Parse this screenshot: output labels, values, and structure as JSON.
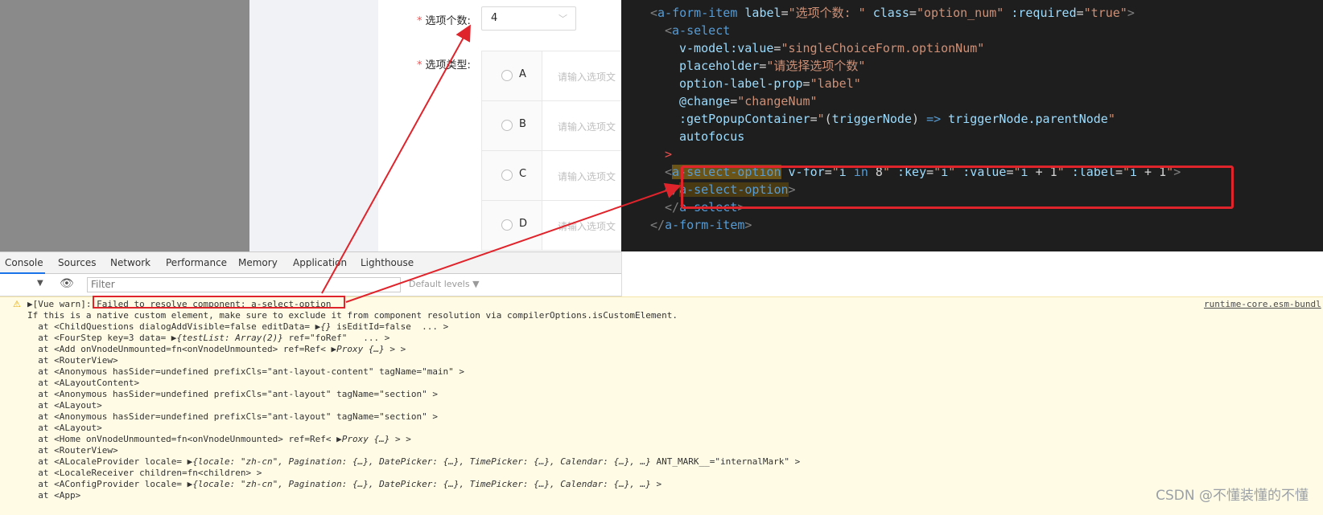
{
  "form": {
    "option_num_label": "选项个数:",
    "option_num_value": "4",
    "option_type_label": "选项类型:",
    "required_mark": "*",
    "input_placeholder": "请输入选项文",
    "options": [
      "A",
      "B",
      "C",
      "D"
    ]
  },
  "code": {
    "lines": [
      {
        "segs": [
          [
            "c-punc",
            "<"
          ],
          [
            "c-tag",
            "a-form-item"
          ],
          [
            "c-op",
            " "
          ],
          [
            "c-attr",
            "label"
          ],
          [
            "c-op",
            "="
          ],
          [
            "c-str",
            "\"选项个数: \""
          ],
          [
            "c-op",
            " "
          ],
          [
            "c-attr",
            "class"
          ],
          [
            "c-op",
            "="
          ],
          [
            "c-str",
            "\"option_num\""
          ],
          [
            "c-op",
            " "
          ],
          [
            "c-attr",
            ":required"
          ],
          [
            "c-op",
            "="
          ],
          [
            "c-str",
            "\"true\""
          ],
          [
            "c-punc",
            ">"
          ]
        ],
        "indent": 1
      },
      {
        "segs": [
          [
            "c-punc",
            "<"
          ],
          [
            "c-tag",
            "a-select"
          ]
        ],
        "indent": 2
      },
      {
        "segs": [
          [
            "c-attr",
            "v-model:value"
          ],
          [
            "c-op",
            "="
          ],
          [
            "c-str",
            "\"singleChoiceForm.optionNum\""
          ]
        ],
        "indent": 3
      },
      {
        "segs": [
          [
            "c-attr",
            "placeholder"
          ],
          [
            "c-op",
            "="
          ],
          [
            "c-str",
            "\"请选择选项个数\""
          ]
        ],
        "indent": 3
      },
      {
        "segs": [
          [
            "c-attr",
            "option-label-prop"
          ],
          [
            "c-op",
            "="
          ],
          [
            "c-str",
            "\"label\""
          ]
        ],
        "indent": 3
      },
      {
        "segs": [
          [
            "c-attr",
            "@change"
          ],
          [
            "c-op",
            "="
          ],
          [
            "c-str",
            "\"changeNum\""
          ]
        ],
        "indent": 3
      },
      {
        "segs": [
          [
            "c-attr",
            ":getPopupContainer"
          ],
          [
            "c-op",
            "="
          ],
          [
            "c-str",
            "\""
          ],
          [
            "c-op",
            "("
          ],
          [
            "c-attr",
            "triggerNode"
          ],
          [
            "c-op",
            ") "
          ],
          [
            "c-tag",
            "=>"
          ],
          [
            "c-op",
            " "
          ],
          [
            "c-attr",
            "triggerNode.parentNode"
          ],
          [
            "c-str",
            "\""
          ]
        ],
        "indent": 3
      },
      {
        "segs": [
          [
            "c-attr",
            "autofocus"
          ]
        ],
        "indent": 3
      },
      {
        "segs": [
          [
            "c-red",
            ">"
          ]
        ],
        "indent": 2
      },
      {
        "segs": [
          [
            "c-punc",
            "<"
          ],
          [
            "c-hl",
            "a-select-option"
          ],
          [
            "c-op",
            " "
          ],
          [
            "c-attr",
            "v-for"
          ],
          [
            "c-op",
            "="
          ],
          [
            "c-str",
            "\""
          ],
          [
            "c-attr",
            "i"
          ],
          [
            "c-op",
            " "
          ],
          [
            "c-tag",
            "in"
          ],
          [
            "c-op",
            " 8"
          ],
          [
            "c-str",
            "\""
          ],
          [
            "c-op",
            " "
          ],
          [
            "c-attr",
            ":key"
          ],
          [
            "c-op",
            "="
          ],
          [
            "c-str",
            "\""
          ],
          [
            "c-attr",
            "i"
          ],
          [
            "c-str",
            "\""
          ],
          [
            "c-op",
            " "
          ],
          [
            "c-attr",
            ":value"
          ],
          [
            "c-op",
            "="
          ],
          [
            "c-str",
            "\""
          ],
          [
            "c-attr",
            "i"
          ],
          [
            "c-op",
            " + 1"
          ],
          [
            "c-str",
            "\""
          ],
          [
            "c-op",
            " "
          ],
          [
            "c-attr",
            ":label"
          ],
          [
            "c-op",
            "="
          ],
          [
            "c-str",
            "\""
          ],
          [
            "c-attr",
            "i"
          ],
          [
            "c-op",
            " + 1"
          ],
          [
            "c-str",
            "\""
          ],
          [
            "c-punc",
            ">"
          ]
        ],
        "indent": 2
      },
      {
        "segs": [
          [
            "c-punc",
            "</"
          ],
          [
            "c-hl2 c-tag",
            "a-select-option"
          ],
          [
            "c-punc",
            ">"
          ]
        ],
        "indent": 2
      },
      {
        "segs": [
          [
            "c-punc",
            "</"
          ],
          [
            "c-tag",
            "a-select"
          ],
          [
            "c-punc",
            ">"
          ]
        ],
        "indent": 2
      },
      {
        "segs": [
          [
            "c-punc",
            "</"
          ],
          [
            "c-tag",
            "a-form-item"
          ],
          [
            "c-punc",
            ">"
          ]
        ],
        "indent": 1
      }
    ]
  },
  "devtools": {
    "tabs": [
      "Console",
      "Sources",
      "Network",
      "Performance",
      "Memory",
      "Application",
      "Lighthouse"
    ],
    "filter_placeholder": "Filter",
    "levels_label": "Default levels ▼",
    "side_link": "runtime-core.esm-bundl"
  },
  "console": {
    "lines": [
      [
        [
          "",
          "▶[Vue warn]: "
        ],
        [
          "",
          "Failed to resolve component: a-select-option"
        ]
      ],
      [
        [
          "",
          "If this is a native custom element, make sure to exclude it from component resolution via compilerOptions.isCustomElement."
        ]
      ],
      [
        [
          "",
          "  at <ChildQuestions dialogAddVisible=false editData= ▶"
        ],
        [
          "italic",
          "{}"
        ],
        [
          "",
          " isEditId=false  ... >"
        ]
      ],
      [
        [
          "",
          "  at <FourStep key=3 data= ▶"
        ],
        [
          "italic",
          "{testList: Array(2)}"
        ],
        [
          "",
          " ref=\"foRef\"   ... >"
        ]
      ],
      [
        [
          "",
          "  at <Add onVnodeUnmounted=fn<onVnodeUnmounted> ref=Ref< ▶"
        ],
        [
          "italic",
          "Proxy {…}"
        ],
        [
          "",
          " > >"
        ]
      ],
      [
        [
          "",
          "  at <RouterView>"
        ]
      ],
      [
        [
          "",
          "  at <Anonymous hasSider=undefined prefixCls=\"ant-layout-content\" tagName=\"main\" >"
        ]
      ],
      [
        [
          "",
          "  at <ALayoutContent>"
        ]
      ],
      [
        [
          "",
          "  at <Anonymous hasSider=undefined prefixCls=\"ant-layout\" tagName=\"section\" >"
        ]
      ],
      [
        [
          "",
          "  at <ALayout>"
        ]
      ],
      [
        [
          "",
          "  at <Anonymous hasSider=undefined prefixCls=\"ant-layout\" tagName=\"section\" >"
        ]
      ],
      [
        [
          "",
          "  at <ALayout>"
        ]
      ],
      [
        [
          "",
          "  at <Home onVnodeUnmounted=fn<onVnodeUnmounted> ref=Ref< ▶"
        ],
        [
          "italic",
          "Proxy {…}"
        ],
        [
          "",
          " > >"
        ]
      ],
      [
        [
          "",
          "  at <RouterView>"
        ]
      ],
      [
        [
          "",
          "  at <ALocaleProvider locale= ▶"
        ],
        [
          "italic",
          "{locale: \"zh-cn\", Pagination: {…}, DatePicker: {…}, TimePicker: {…}, Calendar: {…}, …}"
        ],
        [
          "",
          " ANT_MARK__=\"internalMark\" >"
        ]
      ],
      [
        [
          "",
          "  at <LocaleReceiver children=fn<children> >"
        ]
      ],
      [
        [
          "",
          "  at <AConfigProvider locale= ▶"
        ],
        [
          "italic",
          "{locale: \"zh-cn\", Pagination: {…}, DatePicker: {…}, TimePicker: {…}, Calendar: {…}, …}"
        ],
        [
          "",
          " >"
        ]
      ],
      [
        [
          "",
          "  at <App>"
        ]
      ]
    ]
  },
  "watermark": "CSDN @不懂装懂的不懂"
}
